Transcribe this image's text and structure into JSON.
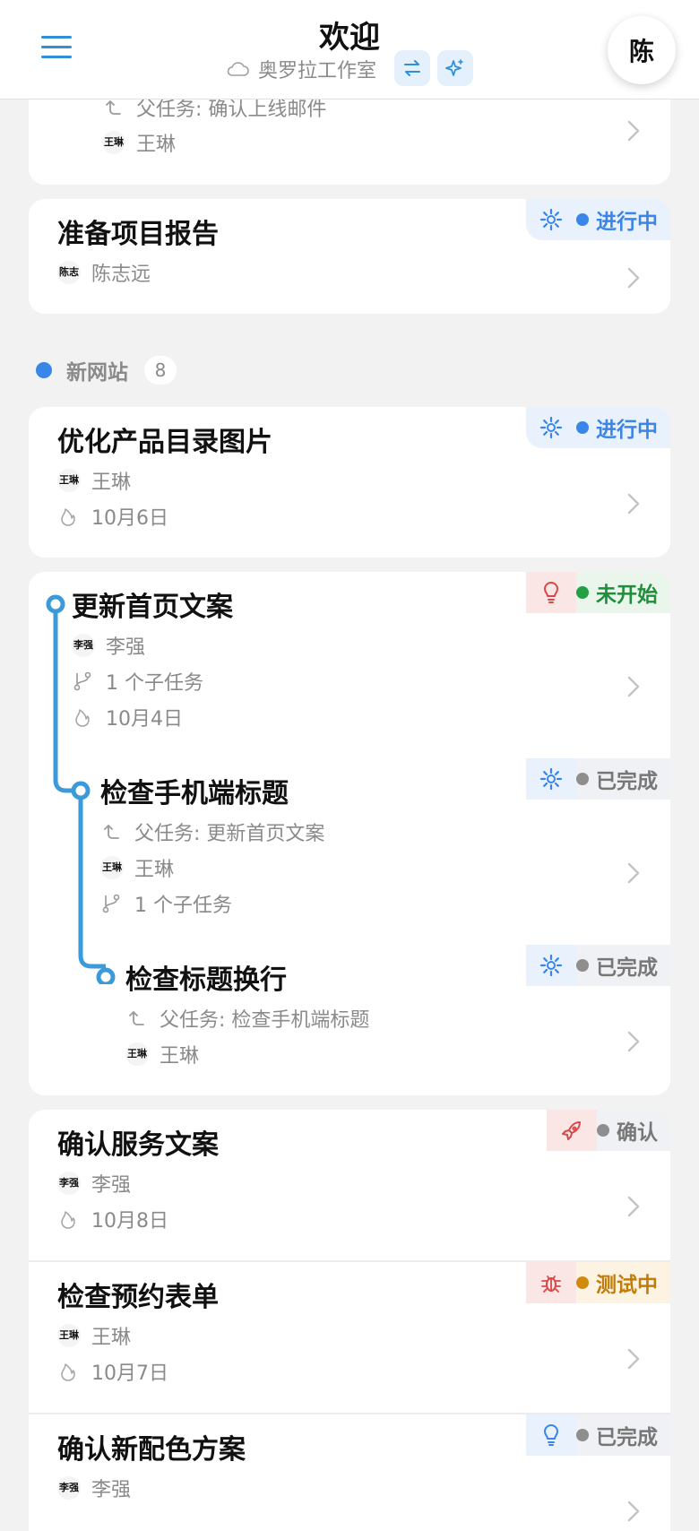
{
  "header": {
    "title": "欢迎",
    "workspace": "奥罗拉工作室",
    "avatar_initial": "陈"
  },
  "badges": {
    "in_progress": "进行中",
    "not_started": "未开始",
    "completed": "已完成",
    "confirm": "确认",
    "testing": "测试中"
  },
  "card0": {
    "parent": "父任务: 确认上线邮件",
    "assignee": "王琳",
    "assignee_mini": "王琳"
  },
  "card1": {
    "title": "准备项目报告",
    "assignee": "陈志远",
    "assignee_mini": "陈志"
  },
  "section": {
    "name": "新网站",
    "count": "8"
  },
  "card2": {
    "title": "优化产品目录图片",
    "assignee": "王琳",
    "assignee_mini": "王琳",
    "due": "10月6日"
  },
  "tree": {
    "t1": {
      "title": "更新首页文案",
      "assignee": "李强",
      "assignee_mini": "李强",
      "subtasks": "1 个子任务",
      "due": "10月4日"
    },
    "t2": {
      "title": "检查手机端标题",
      "parent": "父任务: 更新首页文案",
      "assignee": "王琳",
      "assignee_mini": "王琳",
      "subtasks": "1 个子任务"
    },
    "t3": {
      "title": "检查标题换行",
      "parent": "父任务: 检查手机端标题",
      "assignee": "王琳",
      "assignee_mini": "王琳"
    }
  },
  "list": {
    "r1": {
      "title": "确认服务文案",
      "assignee": "李强",
      "assignee_mini": "李强",
      "due": "10月8日"
    },
    "r2": {
      "title": "检查预约表单",
      "assignee": "王琳",
      "assignee_mini": "王琳",
      "due": "10月7日"
    },
    "r3": {
      "title": "确认新配色方案",
      "assignee": "李强",
      "assignee_mini": "李强"
    }
  },
  "colors": {
    "accent": "#2f8fd8",
    "blue_status": "#3a86e8",
    "green_status": "#22a043",
    "gray_status": "#8e8e8e",
    "orange_status": "#d08a10",
    "tree_line": "#3b9ad9"
  },
  "icons": [
    "menu-icon",
    "cloud-icon",
    "swap-icon",
    "sparkle-icon",
    "gear-icon",
    "lightbulb-icon",
    "rocket-icon",
    "bug-icon",
    "parent-arrow-icon",
    "branch-icon",
    "flame-icon",
    "chevron-right-icon"
  ]
}
